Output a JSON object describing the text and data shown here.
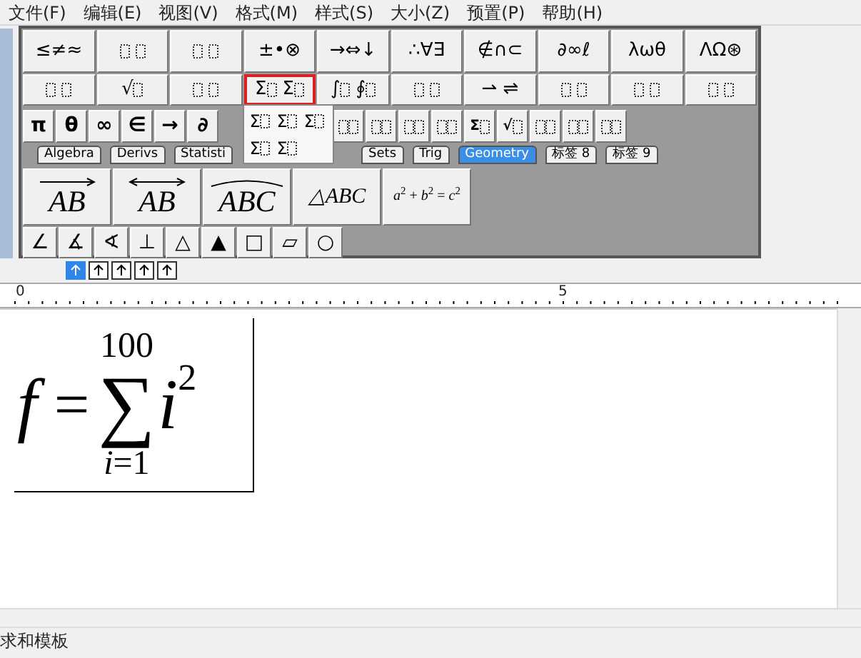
{
  "menu": [
    "文件(F)",
    "编辑(E)",
    "视图(V)",
    "格式(M)",
    "样式(S)",
    "大小(Z)",
    "预置(P)",
    "帮助(H)"
  ],
  "palette": {
    "row_1": [
      {
        "kind": "text",
        "label": "≤≠≈"
      },
      {
        "kind": "slots"
      },
      {
        "kind": "slots"
      },
      {
        "kind": "text",
        "label": "±•⊗"
      },
      {
        "kind": "text",
        "label": "→⇔↓"
      },
      {
        "kind": "text",
        "label": "∴∀∃"
      },
      {
        "kind": "text",
        "label": "∉∩⊂"
      },
      {
        "kind": "text",
        "label": "∂∞ℓ"
      },
      {
        "kind": "text",
        "label": "λωθ"
      },
      {
        "kind": "text",
        "label": "ΛΩ⊛"
      }
    ],
    "row_2": [
      {
        "kind": "slots",
        "selected": false
      },
      {
        "kind": "template",
        "symbols": [
          "√"
        ],
        "selected": false
      },
      {
        "kind": "slots",
        "selected": false
      },
      {
        "kind": "template",
        "symbols": [
          "Σ",
          "Σ"
        ],
        "selected": true
      },
      {
        "kind": "template",
        "symbols": [
          "∫",
          "∮"
        ],
        "selected": false
      },
      {
        "kind": "slots",
        "selected": false
      },
      {
        "kind": "text",
        "label": "⇀ ⇌",
        "selected": false
      },
      {
        "kind": "slots",
        "selected": false
      },
      {
        "kind": "slots",
        "selected": false
      },
      {
        "kind": "slots",
        "selected": false
      }
    ],
    "row_3_left": [
      {
        "kind": "text",
        "label": "π"
      },
      {
        "kind": "text",
        "label": "θ"
      },
      {
        "kind": "text",
        "label": "∞"
      },
      {
        "kind": "text",
        "label": "∈"
      },
      {
        "kind": "text",
        "label": "→"
      },
      {
        "kind": "text",
        "label": "∂"
      }
    ],
    "row_3_right": [
      {
        "kind": "slots"
      },
      {
        "kind": "slots"
      },
      {
        "kind": "slots"
      },
      {
        "kind": "slots"
      },
      {
        "kind": "template",
        "symbols": [
          "Σ"
        ]
      },
      {
        "kind": "template",
        "symbols": [
          "√"
        ]
      },
      {
        "kind": "slots"
      },
      {
        "kind": "slots"
      },
      {
        "kind": "slots"
      }
    ],
    "tabs_left": [
      {
        "label": "Algebra",
        "selected": false
      },
      {
        "label": "Derivs",
        "selected": false
      },
      {
        "label": "Statisti",
        "selected": false
      }
    ],
    "tabs_right": [
      {
        "label": "Sets",
        "selected": false
      },
      {
        "label": "Trig",
        "selected": false
      },
      {
        "label": "Geometry",
        "selected": true
      },
      {
        "label": "标签 8",
        "selected": false
      },
      {
        "label": "标签 9",
        "selected": false
      }
    ],
    "geometry_templates": [
      {
        "kind": "vector",
        "text": "AB"
      },
      {
        "kind": "line",
        "text": "AB"
      },
      {
        "kind": "arc",
        "text": "ABC"
      },
      {
        "kind": "plain",
        "text": "△ABC"
      },
      {
        "kind": "formula",
        "text": "*a*$^{2}$ + *b*$^{2}$ = *c*$^{2}$"
      }
    ],
    "geometry_symbols": [
      "∠",
      "∡",
      "∢",
      "⊥",
      "△",
      "▲",
      "□",
      "▱",
      "○"
    ],
    "dropdown": [
      {
        "symbol": "Σ"
      },
      {
        "symbol": "Σ"
      },
      {
        "symbol": "Σ"
      },
      {
        "symbol": "Σ"
      },
      {
        "symbol": "Σ"
      }
    ]
  },
  "nudge_buttons": [
    {
      "selected": true
    },
    {
      "selected": false
    },
    {
      "selected": false
    },
    {
      "selected": false
    },
    {
      "selected": false
    }
  ],
  "ruler": {
    "labels": [
      "0",
      "5"
    ]
  },
  "equation": {
    "function": "f",
    "equals": "=",
    "operator": "∑",
    "upper_limit": "100",
    "lower_limit": "*i*=1",
    "term": "i",
    "exponent": "2"
  },
  "status_bar": "求和模板"
}
